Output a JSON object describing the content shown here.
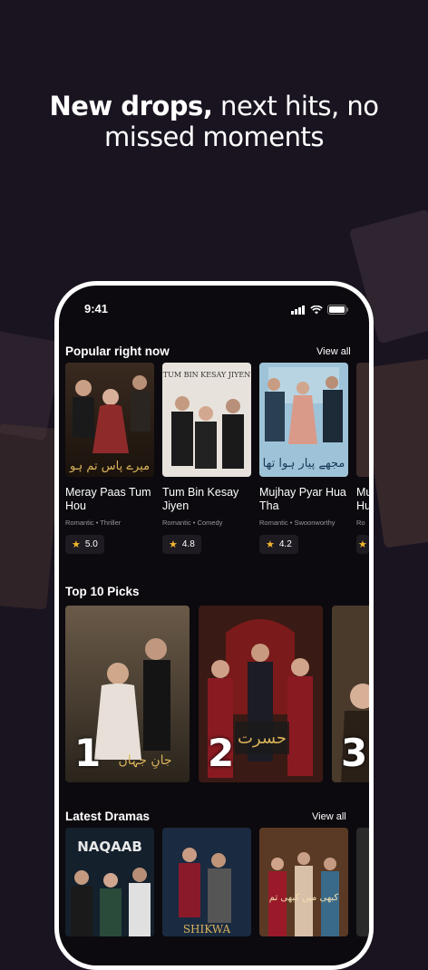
{
  "headline": {
    "bold": "New drops,",
    "rest_line1": " next hits, no",
    "rest_line2": "missed moments"
  },
  "status_bar": {
    "time": "9:41"
  },
  "popular": {
    "title": "Popular right now",
    "view_all": "View all",
    "items": [
      {
        "title": "Meray Paas Tum Hou",
        "meta": "Romantic • Thriller",
        "rating": "5.0",
        "poster_text": "میرے پاس تم ہو"
      },
      {
        "title": "Tum Bin Kesay Jiyen",
        "meta": "Romantic • Comedy",
        "rating": "4.8",
        "poster_text": "TUM BIN KESAY JIYEN"
      },
      {
        "title": "Mujhay Pyar Hua Tha",
        "meta": "Romantic • Swoonworthy",
        "rating": "4.2",
        "poster_text": "مجھے پیار ہوا تھا"
      },
      {
        "title": "Mu Hu",
        "meta": "Ro",
        "rating": ""
      }
    ]
  },
  "top10": {
    "title": "Top 10 Picks",
    "items": [
      {
        "rank": "1",
        "poster_text": "جانِ جہاں"
      },
      {
        "rank": "2",
        "poster_text": "حسرت"
      },
      {
        "rank": "3"
      }
    ]
  },
  "latest": {
    "title": "Latest Dramas",
    "view_all": "View all",
    "items": [
      {
        "poster_text": "NAQAAB"
      },
      {
        "poster_text": "SHIKWA"
      },
      {
        "poster_text": "کبھی میں کبھی تم"
      }
    ]
  },
  "colors": {
    "background": "#1a1420",
    "screen": "#0c0a0e",
    "star": "#f5b82e"
  }
}
